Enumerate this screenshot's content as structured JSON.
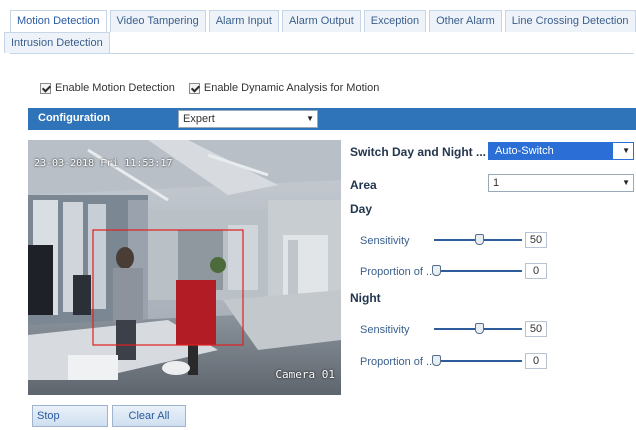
{
  "tabs": {
    "row1": [
      "Motion Detection",
      "Video Tampering",
      "Alarm Input",
      "Alarm Output",
      "Exception",
      "Other Alarm",
      "Line Crossing Detection"
    ],
    "row2": [
      "Intrusion Detection"
    ]
  },
  "checkboxes": {
    "enable_motion": "Enable Motion Detection",
    "enable_dynamic": "Enable Dynamic Analysis for Motion"
  },
  "config": {
    "label": "Configuration",
    "mode": "Expert"
  },
  "video": {
    "timestamp": "23-03-2018 Fri 11:53:17",
    "camera_label": "Camera 01"
  },
  "settings": {
    "switch_label": "Switch Day and Night ...",
    "switch_value": "Auto-Switch",
    "area_label": "Area",
    "area_value": "1",
    "day_heading": "Day",
    "night_heading": "Night",
    "day": {
      "sensitivity_label": "Sensitivity",
      "sensitivity": "50",
      "proportion_label": "Proportion of ...",
      "proportion": "0"
    },
    "night": {
      "sensitivity_label": "Sensitivity",
      "sensitivity": "50",
      "proportion_label": "Proportion of ...",
      "proportion": "0"
    }
  },
  "buttons": {
    "stop_drawing": "Stop Drawing",
    "clear_all": "Clear All"
  },
  "colors": {
    "accent": "#2f73b8",
    "highlight": "#2b6fd6",
    "region": "#e02020"
  }
}
